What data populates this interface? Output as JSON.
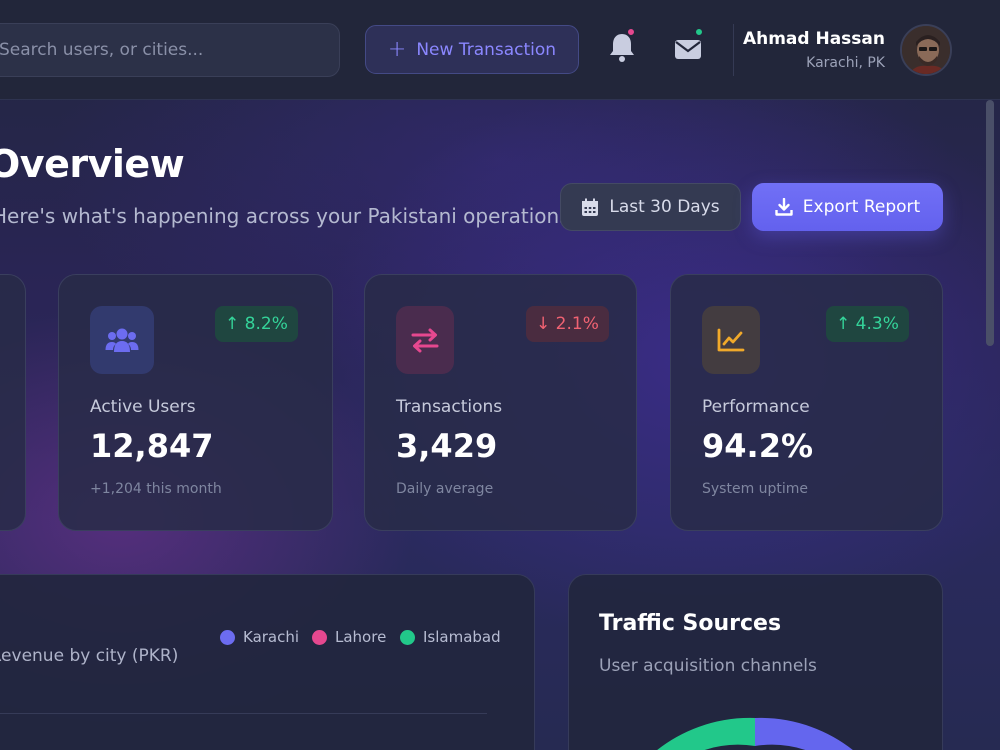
{
  "header": {
    "search_placeholder": "Search users, or cities...",
    "new_transaction_label": "New Transaction",
    "notification_dot_color": "#e5488f",
    "message_dot_color": "#22c88a",
    "user": {
      "name": "Ahmad Hassan",
      "location": "Karachi, PK"
    }
  },
  "page": {
    "title": "Overview",
    "subtitle": "Here's what's happening across your Pakistani operations today.",
    "range_label": "Last 30 Days",
    "export_label": "Export Report"
  },
  "stats": [
    {
      "icon": "users-icon",
      "label": "Active Users",
      "value": "12,847",
      "change": "8.2%",
      "trend": "up",
      "footnote": "+1,204 this month",
      "accent": "#6c6cf0"
    },
    {
      "icon": "transfer-icon",
      "label": "Transactions",
      "value": "3,429",
      "change": "2.1%",
      "trend": "down",
      "footnote": "Daily average",
      "accent": "#e5488f"
    },
    {
      "icon": "chart-line-icon",
      "label": "Performance",
      "value": "94.2%",
      "change": "4.3%",
      "trend": "up",
      "footnote": "System uptime",
      "accent": "#f0a92a"
    }
  ],
  "revenue_panel": {
    "subtitle": "Revenue by city (PKR)",
    "legend": [
      {
        "name": "Karachi",
        "color": "#6c6cf0"
      },
      {
        "name": "Lahore",
        "color": "#e5488f"
      },
      {
        "name": "Islamabad",
        "color": "#22c88a"
      }
    ]
  },
  "traffic_panel": {
    "title": "Traffic Sources",
    "subtitle": "User acquisition channels"
  },
  "colors": {
    "up": "#34d399",
    "down": "#f06272",
    "primary": "#6c6cf0"
  }
}
